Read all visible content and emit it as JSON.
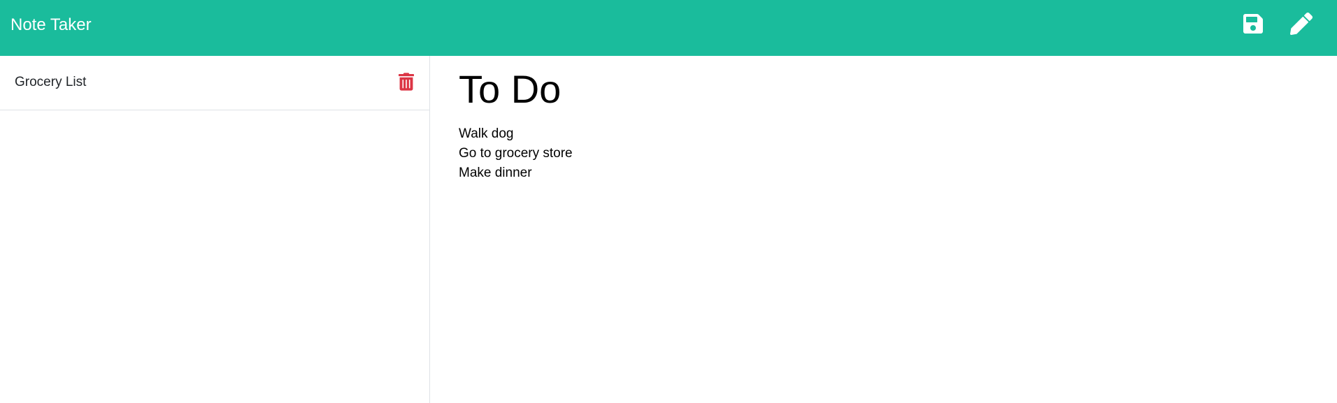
{
  "navbar": {
    "brand": "Note Taker",
    "icons": {
      "save": "save-icon",
      "write": "pencil-icon"
    },
    "color": "#1abc9c"
  },
  "sidebar": {
    "notes": [
      {
        "title": "Grocery List",
        "delete_icon": "trash-icon",
        "delete_color": "#dc3545"
      }
    ]
  },
  "editor": {
    "title": "To Do",
    "body_lines": [
      "Walk dog",
      "Go to grocery store",
      "Make dinner"
    ]
  }
}
